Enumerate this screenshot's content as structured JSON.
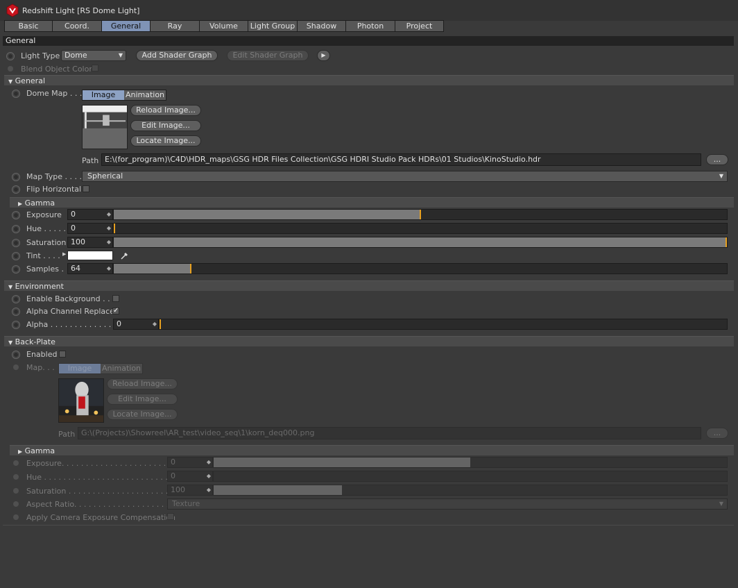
{
  "window": {
    "title": "Redshift Light [RS Dome Light]"
  },
  "tabs": [
    "Basic",
    "Coord.",
    "General",
    "Ray",
    "Volume",
    "Light Group",
    "Shadow",
    "Photon",
    "Project"
  ],
  "active_tab": "General",
  "section_title": "General",
  "light_type": {
    "label": "Light Type",
    "value": "Dome",
    "add_shader": "Add Shader Graph",
    "edit_shader": "Edit Shader Graph"
  },
  "blend_object_color": {
    "label": "Blend Object Color"
  },
  "general_group": {
    "title": "General",
    "dome_map": {
      "label": "Dome Map . . .",
      "mode_image": "Image",
      "mode_animation": "Animation",
      "reload": "Reload Image...",
      "edit": "Edit Image...",
      "locate": "Locate Image...",
      "path_label": "Path",
      "path": "E:\\(for_program)\\C4D\\HDR_maps\\GSG HDR Files Collection\\GSG HDRI Studio Pack HDRs\\01 Studios\\KinoStudio.hdr",
      "browse": "..."
    },
    "map_type": {
      "label": "Map Type . . . .",
      "value": "Spherical"
    },
    "flip_horizontal": {
      "label": "Flip Horizontal"
    }
  },
  "gamma_group": {
    "title": "Gamma",
    "exposure": {
      "label": "Exposure",
      "value": "0",
      "fill": 0.5
    },
    "hue": {
      "label": "Hue . . . . .",
      "value": "0",
      "fill": 0.0
    },
    "saturation": {
      "label": "Saturation",
      "value": "100",
      "fill": 1.0
    },
    "tint": {
      "label": "Tint . . . ."
    },
    "samples": {
      "label": "Samples .",
      "value": "64",
      "fill": 0.125
    }
  },
  "environment_group": {
    "title": "Environment",
    "enable_background": {
      "label": "Enable Background . . ."
    },
    "alpha_channel_replace": {
      "label": "Alpha Channel Replace",
      "checked": true
    },
    "alpha": {
      "label": "Alpha . . . . . . . . . . . . . .",
      "value": "0",
      "fill": 0.0
    }
  },
  "backplate_group": {
    "title": "Back-Plate",
    "enabled": {
      "label": "Enabled"
    },
    "map": {
      "label": "Map. . .",
      "mode_image": "Image",
      "mode_animation": "Animation",
      "reload": "Reload Image...",
      "edit": "Edit Image...",
      "locate": "Locate Image...",
      "path_label": "Path",
      "path": "G:\\(Projects)\\Showreel\\AR_test\\video_seq\\1\\korn_deq000.png",
      "browse": "..."
    }
  },
  "backplate_gamma": {
    "title": "Gamma",
    "exposure": {
      "label": "Exposure. . . . . . . . . . . . . . . . . . . . . . . . .",
      "value": "0",
      "fill": 0.5
    },
    "hue": {
      "label": "Hue . . . . . . . . . . . . . . . . . . . . . . . . . . . .",
      "value": "0",
      "fill": 0.0
    },
    "saturation": {
      "label": "Saturation . . . . . . . . . . . . . . . . . . . . . . .",
      "value": "100",
      "fill": 0.25
    },
    "aspect_ratio": {
      "label": "Aspect Ratio. . . . . . . . . . . . . . . . . . . . . .",
      "value": "Texture"
    },
    "apply_camera": {
      "label": "Apply Camera Exposure Compensation"
    }
  },
  "colors": {
    "accent_tab": "#7f93b6",
    "slider_knob": "#e6a020",
    "tint": "#ffffff"
  }
}
